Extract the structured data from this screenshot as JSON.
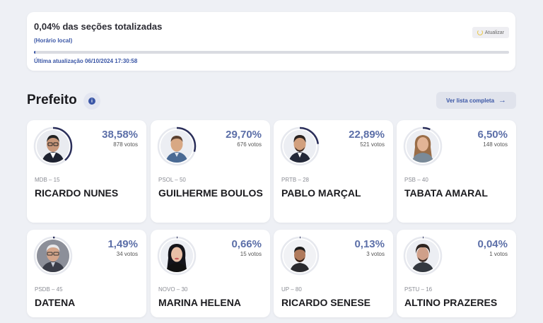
{
  "status": {
    "sections_totalized": "0,04% das seções totalizadas",
    "local_time_label": "(Horário local)",
    "refresh_label": "Atualizar",
    "progress_percent": 0.04,
    "last_update": "Última atualização 06/10/2024 17:30:58"
  },
  "section": {
    "title": "Prefeito",
    "info_icon": "i",
    "full_list_label": "Ver lista completa"
  },
  "colors": {
    "accent": "#3a56a6",
    "ring_track": "#e6e8ee",
    "ring_fill": "#2b2f5a"
  },
  "candidates": [
    {
      "party": "MDB – 15",
      "name": "RICARDO NUNES",
      "percent": "38,58%",
      "votes": "878 votos",
      "share": 38.58
    },
    {
      "party": "PSOL – 50",
      "name": "GUILHERME BOULOS",
      "percent": "29,70%",
      "votes": "676 votos",
      "share": 29.7
    },
    {
      "party": "PRTB – 28",
      "name": "PABLO MARÇAL",
      "percent": "22,89%",
      "votes": "521 votos",
      "share": 22.89
    },
    {
      "party": "PSB – 40",
      "name": "TABATA AMARAL",
      "percent": "6,50%",
      "votes": "148 votos",
      "share": 6.5
    },
    {
      "party": "PSDB – 45",
      "name": "DATENA",
      "percent": "1,49%",
      "votes": "34 votos",
      "share": 1.49
    },
    {
      "party": "NOVO – 30",
      "name": "MARINA HELENA",
      "percent": "0,66%",
      "votes": "15 votos",
      "share": 0.66
    },
    {
      "party": "UP – 80",
      "name": "RICARDO SENESE",
      "percent": "0,13%",
      "votes": "3 votos",
      "share": 0.13
    },
    {
      "party": "PSTU – 16",
      "name": "ALTINO PRAZERES",
      "percent": "0,04%",
      "votes": "1 votos",
      "share": 0.04
    }
  ]
}
